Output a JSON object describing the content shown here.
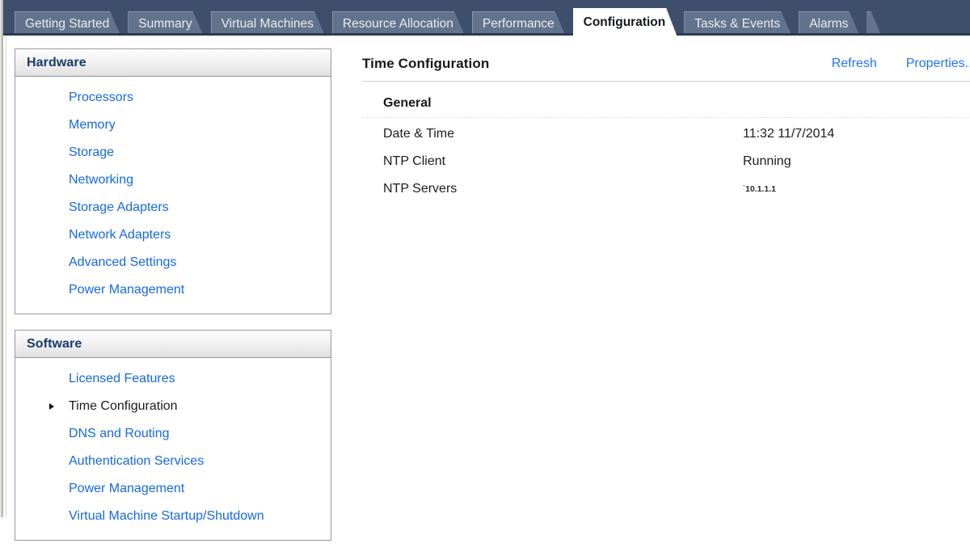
{
  "tabs": [
    {
      "label": "Getting Started",
      "active": false
    },
    {
      "label": "Summary",
      "active": false
    },
    {
      "label": "Virtual Machines",
      "active": false
    },
    {
      "label": "Resource Allocation",
      "active": false
    },
    {
      "label": "Performance",
      "active": false
    },
    {
      "label": "Configuration",
      "active": true
    },
    {
      "label": "Tasks & Events",
      "active": false
    },
    {
      "label": "Alarms",
      "active": false
    },
    {
      "label": "",
      "active": false
    }
  ],
  "sidebar": {
    "panels": [
      {
        "title": "Hardware",
        "items": [
          {
            "label": "Processors",
            "selected": false
          },
          {
            "label": "Memory",
            "selected": false
          },
          {
            "label": "Storage",
            "selected": false
          },
          {
            "label": "Networking",
            "selected": false
          },
          {
            "label": "Storage Adapters",
            "selected": false
          },
          {
            "label": "Network Adapters",
            "selected": false
          },
          {
            "label": "Advanced Settings",
            "selected": false
          },
          {
            "label": "Power Management",
            "selected": false
          }
        ]
      },
      {
        "title": "Software",
        "items": [
          {
            "label": "Licensed Features",
            "selected": false
          },
          {
            "label": "Time Configuration",
            "selected": true
          },
          {
            "label": "DNS and Routing",
            "selected": false
          },
          {
            "label": "Authentication Services",
            "selected": false
          },
          {
            "label": "Power Management",
            "selected": false
          },
          {
            "label": "Virtual Machine Startup/Shutdown",
            "selected": false
          }
        ]
      }
    ]
  },
  "main": {
    "title": "Time Configuration",
    "actions": [
      {
        "label": "Refresh"
      },
      {
        "label": "Properties..."
      }
    ],
    "section_title": "General",
    "properties": [
      {
        "label": "Date & Time",
        "value": "11:32  11/7/2014",
        "small": false
      },
      {
        "label": "NTP Client",
        "value": "Running",
        "small": false
      },
      {
        "label": "NTP Servers",
        "value": "10.1.1.1",
        "small": true
      }
    ]
  },
  "colors": {
    "tabstrip_bg": "#3e4f6b",
    "tab_inactive_bg": "#64738d",
    "tab_active_bg": "#ffffff",
    "link_blue": "#1569e0",
    "header_blue": "#1a3a6b",
    "action_link": "#2176f0"
  }
}
